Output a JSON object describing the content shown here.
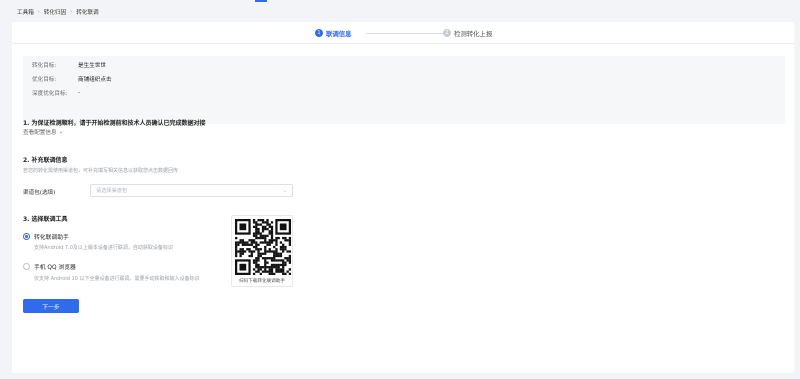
{
  "breadcrumb": {
    "items": [
      "工具箱",
      "转化归因",
      "转化联调"
    ]
  },
  "steps": [
    {
      "num": "1",
      "label": "联调信息"
    },
    {
      "num": "2",
      "label": "检测转化上报"
    }
  ],
  "info": {
    "rows": [
      {
        "key": "转化目标:",
        "value": "是生生世世"
      },
      {
        "key": "优化目标:",
        "value": "商铺组织点击"
      },
      {
        "key": "深度优化目标:",
        "value": "-"
      }
    ]
  },
  "section1": {
    "title": "1. 为保证检测顺利，请于开始检测前和技术人员确认已完成数据对接",
    "toggle": "查看配置信息"
  },
  "section2": {
    "title": "2. 补充联调信息",
    "desc": "若您的转化需使用渠道包，可补充填写相关信息以获取您点击数据回传",
    "select_label": "渠道包(选填)",
    "select_placeholder": "请选择渠道包"
  },
  "section3": {
    "title": "3. 选择联调工具",
    "options": [
      {
        "label": "转化联调助手",
        "desc": "支持Android 7.0及以上版本设备进行联调，自动获取设备标识"
      },
      {
        "label": "手机 QQ 浏览器",
        "desc": "仅支持 Android 10 以下全量设备进行联调，需要手动获取和输入设备标识"
      }
    ],
    "qr_caption": "扫码下载转化联调助手"
  },
  "next_button": "下一步",
  "colors": {
    "accent": "#2f6bea",
    "background": "#f3f4f7"
  }
}
